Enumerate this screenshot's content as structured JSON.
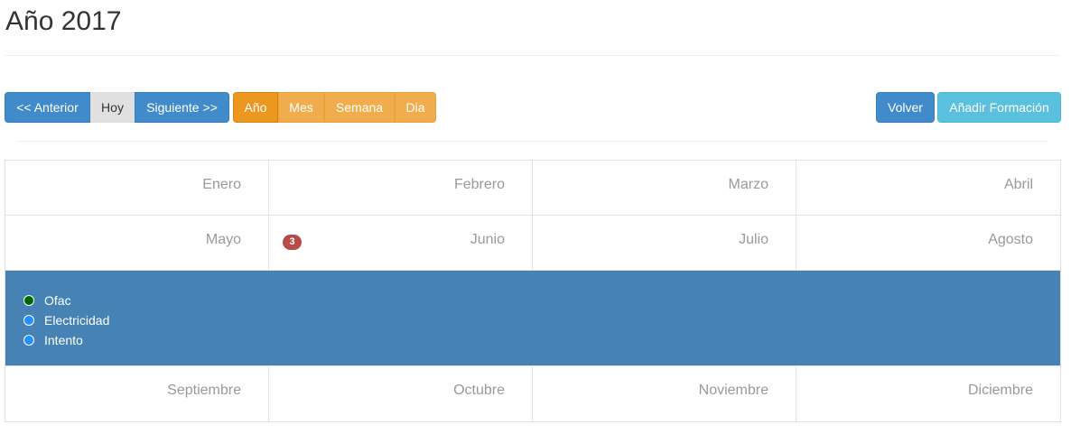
{
  "page": {
    "title": "Año 2017"
  },
  "nav": {
    "prev": "<< Anterior",
    "today": "Hoy",
    "next": "Siguiente >>"
  },
  "views": {
    "year": "Año",
    "month": "Mes",
    "week": "Semana",
    "day": "Dia",
    "active": "year"
  },
  "actions": {
    "back": "Volver",
    "add": "Añadir Formación"
  },
  "calendar": {
    "months": [
      "Enero",
      "Febrero",
      "Marzo",
      "Abril",
      "Mayo",
      "Junio",
      "Julio",
      "Agosto",
      "Septiembre",
      "Octubre",
      "Noviembre",
      "Diciembre"
    ],
    "june_badge": "3",
    "events": [
      {
        "label": "Ofac",
        "color": "#006400"
      },
      {
        "label": "Electricidad",
        "color": "#1e90ff"
      },
      {
        "label": "Intento",
        "color": "#1e90ff"
      }
    ]
  },
  "colors": {
    "primary": "#428bca",
    "warning": "#f0ad4e",
    "warning_active": "#ec971f",
    "info": "#5bc0de",
    "events_bg": "#4682b4",
    "badge": "#b94a48"
  }
}
